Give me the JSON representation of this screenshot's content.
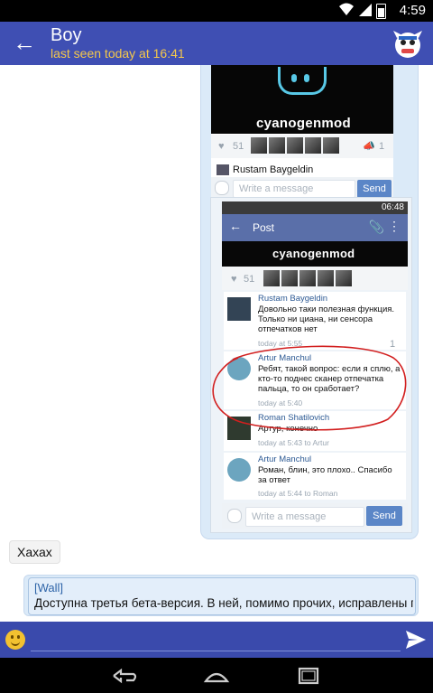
{
  "status_bar": {
    "time": "4:59"
  },
  "header": {
    "contact_name": "Boy",
    "last_seen": "last seen today at 16:41"
  },
  "forwarded_screenshot": {
    "post_preview": {
      "video_label": "cyanogenmod",
      "likes": "51",
      "shares": "1",
      "commenter": "Rustam Baygeldin",
      "message_placeholder": "Write a message",
      "send_label": "Send"
    },
    "post_screen": {
      "time": "06:48",
      "title": "Post",
      "video_label": "cyanogenmod",
      "likes": "51",
      "comments": [
        {
          "name": "Rustam Baygeldin",
          "text": "Довольно таки полезная функция. Только ни циана, ни сенсора отпечатков нет",
          "time": "today at 5:55",
          "likes": "1"
        },
        {
          "name": "Artur Manchul",
          "text": "Ребят, такой вопрос: если я сплю, а кто-то поднес сканер отпечатка пальца, то он сработает?",
          "time": "today at 5:40"
        },
        {
          "name": "Roman Shatilovich",
          "text": "Артур, конечно",
          "time": "today at 5:43 to Artur"
        },
        {
          "name": "Artur Manchul",
          "text": "Роман, блин, это плохо.. Спасибо за ответ",
          "time": "today at 5:44 to Roman"
        }
      ],
      "message_placeholder": "Write a message",
      "send_label": "Send"
    }
  },
  "messages": {
    "incoming": "Хахах",
    "wall_tag": "[Wall]",
    "wall_text": "Доступна третья бета-версия. В ней, помимо прочих, исправлены пр..."
  },
  "colors": {
    "app_bar": "#3f4fb3",
    "last_seen": "#f5c84a",
    "outgoing_bubble": "#dbeaf8",
    "annotation": "#d21f1f"
  }
}
